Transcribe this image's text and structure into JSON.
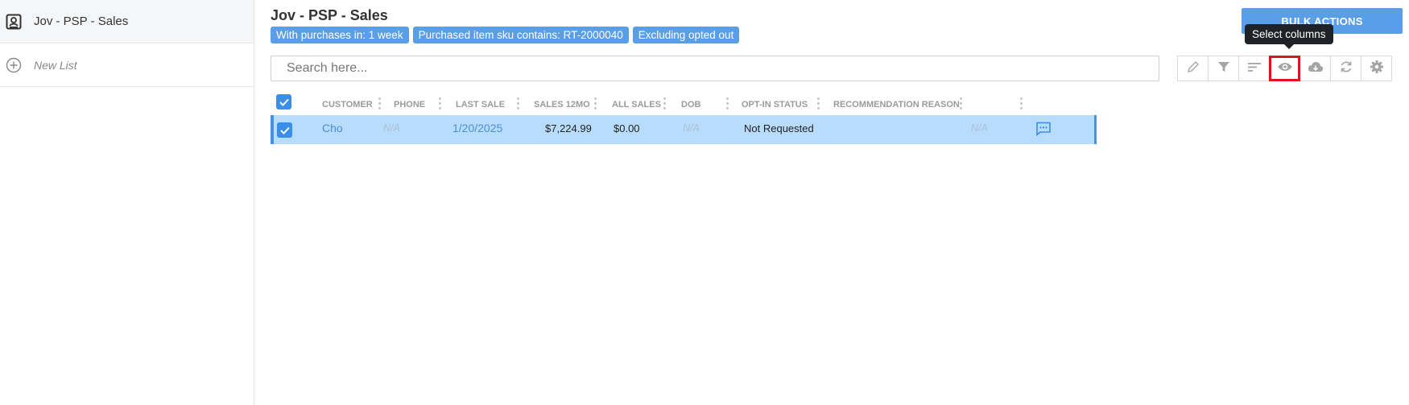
{
  "sidebar": {
    "items": [
      {
        "label": "Jov - PSP - Sales",
        "icon": "contact-card-icon",
        "active": true
      },
      {
        "label": "New List",
        "icon": "add-circle-icon",
        "active": false
      }
    ]
  },
  "header": {
    "title": "Jov - PSP - Sales",
    "filters": [
      "With purchases in: 1 week",
      "Purchased item sku contains: RT-2000040",
      "Excluding opted out"
    ],
    "bulk_actions_label": "BULK ACTIONS",
    "tooltip": "Select columns"
  },
  "search": {
    "placeholder": "Search here...",
    "value": ""
  },
  "toolbar": {
    "buttons": [
      "pencil-icon",
      "filter-icon",
      "sort-icon",
      "eye-icon",
      "cloud-download-icon",
      "refresh-icon",
      "gear-icon"
    ]
  },
  "table": {
    "columns": [
      "CUSTOMER",
      "PHONE",
      "LAST SALE",
      "SALES 12MO",
      "ALL SALES",
      "DOB",
      "OPT-IN STATUS",
      "RECOMMENDATION REASON"
    ],
    "rows": [
      {
        "customer": "Cho",
        "phone": "N/A",
        "last_sale": "1/20/2025",
        "sales_12mo": "$7,224.99",
        "all_sales": "$0.00",
        "dob": "N/A",
        "opt_in_status": "Not Requested",
        "recommendation_reason": "",
        "extra": "N/A",
        "selected": true
      }
    ]
  },
  "colors": {
    "accent": "#5b9ee8",
    "row_selected": "#b8dcfb",
    "highlight": "#e0151b"
  }
}
